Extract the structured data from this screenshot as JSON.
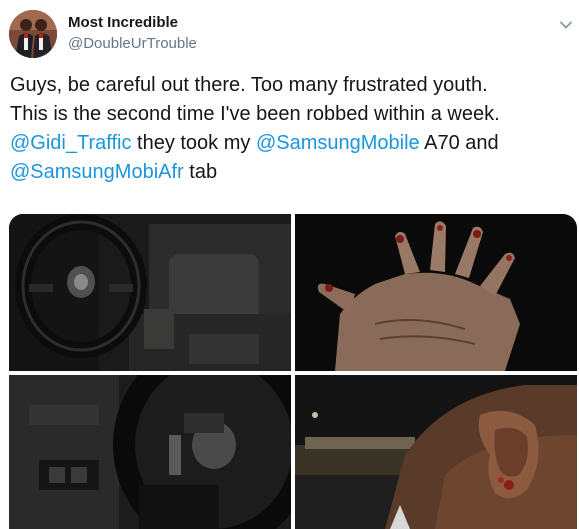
{
  "tweet": {
    "display_name": "Most Incredible",
    "handle": "@DoubleUrTrouble",
    "text": {
      "line1": "Guys, be careful out there. Too many frustrated youth.",
      "line2": "This is the second time I've been robbed within a week.",
      "mention_1": "@Gidi_Traffic",
      "mid_1": " they took my ",
      "mention_2": "@SamsungMobile",
      "mid_2": " A70 and",
      "mention_3": "@SamsungMobiAfr",
      "end": " tab"
    }
  },
  "icons": {
    "avatar": "profile-photo-avatar",
    "caret": "chevron-down-icon"
  },
  "media": {
    "photos": [
      "car-interior-steering-wheel-photo",
      "bleeding-hand-photo",
      "car-dashboard-photo",
      "injured-ear-photo"
    ]
  },
  "colors": {
    "link": "#1b95e0",
    "text": "#14171a",
    "secondary": "#657786"
  }
}
